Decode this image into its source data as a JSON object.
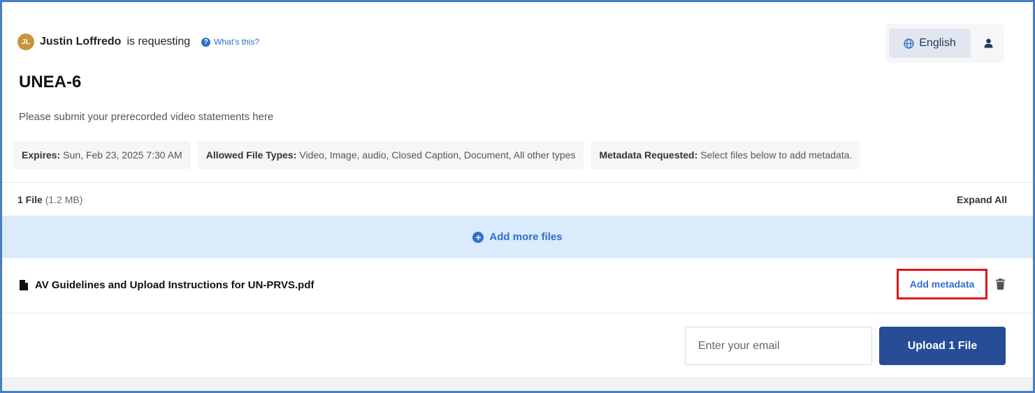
{
  "requester": {
    "initials": "JL",
    "name": "Justin Loffredo",
    "suffix": "is requesting",
    "whats_this": "What's this?"
  },
  "language": {
    "label": "English",
    "icon": "globe-icon"
  },
  "user_icon": "user-icon",
  "request": {
    "title": "UNEA-6",
    "description": "Please submit your prerecorded video statements here"
  },
  "info": {
    "expires_label": "Expires:",
    "expires_value": "Sun, Feb 23, 2025 7:30 AM",
    "types_label": "Allowed File Types:",
    "types_value": "Video, Image, audio, Closed Caption, Document, All other types",
    "metadata_label": "Metadata Requested:",
    "metadata_value": "Select files below to add metadata."
  },
  "files_summary": {
    "count": "1 File",
    "size": "(1.2 MB)",
    "expand_all": "Expand All"
  },
  "add_more": "Add more files",
  "files": [
    {
      "name": "AV Guidelines and Upload Instructions for UN-PRVS.pdf",
      "action": "Add metadata"
    }
  ],
  "upload": {
    "email_placeholder": "Enter your email",
    "button": "Upload 1 File"
  },
  "colors": {
    "accent": "#2f6fd0",
    "primary_button": "#264d96",
    "highlight_border": "#e0161b",
    "avatar": "#c9943c",
    "add_more_bg": "#dbebfb"
  }
}
